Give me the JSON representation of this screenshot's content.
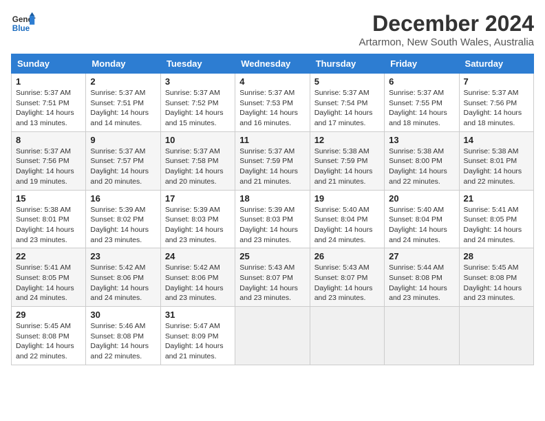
{
  "header": {
    "logo_line1": "General",
    "logo_line2": "Blue",
    "month": "December 2024",
    "location": "Artarmon, New South Wales, Australia"
  },
  "weekdays": [
    "Sunday",
    "Monday",
    "Tuesday",
    "Wednesday",
    "Thursday",
    "Friday",
    "Saturday"
  ],
  "weeks": [
    [
      {
        "day": "1",
        "sunrise": "Sunrise: 5:37 AM",
        "sunset": "Sunset: 7:51 PM",
        "daylight": "Daylight: 14 hours and 13 minutes."
      },
      {
        "day": "2",
        "sunrise": "Sunrise: 5:37 AM",
        "sunset": "Sunset: 7:51 PM",
        "daylight": "Daylight: 14 hours and 14 minutes."
      },
      {
        "day": "3",
        "sunrise": "Sunrise: 5:37 AM",
        "sunset": "Sunset: 7:52 PM",
        "daylight": "Daylight: 14 hours and 15 minutes."
      },
      {
        "day": "4",
        "sunrise": "Sunrise: 5:37 AM",
        "sunset": "Sunset: 7:53 PM",
        "daylight": "Daylight: 14 hours and 16 minutes."
      },
      {
        "day": "5",
        "sunrise": "Sunrise: 5:37 AM",
        "sunset": "Sunset: 7:54 PM",
        "daylight": "Daylight: 14 hours and 17 minutes."
      },
      {
        "day": "6",
        "sunrise": "Sunrise: 5:37 AM",
        "sunset": "Sunset: 7:55 PM",
        "daylight": "Daylight: 14 hours and 18 minutes."
      },
      {
        "day": "7",
        "sunrise": "Sunrise: 5:37 AM",
        "sunset": "Sunset: 7:56 PM",
        "daylight": "Daylight: 14 hours and 18 minutes."
      }
    ],
    [
      {
        "day": "8",
        "sunrise": "Sunrise: 5:37 AM",
        "sunset": "Sunset: 7:56 PM",
        "daylight": "Daylight: 14 hours and 19 minutes."
      },
      {
        "day": "9",
        "sunrise": "Sunrise: 5:37 AM",
        "sunset": "Sunset: 7:57 PM",
        "daylight": "Daylight: 14 hours and 20 minutes."
      },
      {
        "day": "10",
        "sunrise": "Sunrise: 5:37 AM",
        "sunset": "Sunset: 7:58 PM",
        "daylight": "Daylight: 14 hours and 20 minutes."
      },
      {
        "day": "11",
        "sunrise": "Sunrise: 5:37 AM",
        "sunset": "Sunset: 7:59 PM",
        "daylight": "Daylight: 14 hours and 21 minutes."
      },
      {
        "day": "12",
        "sunrise": "Sunrise: 5:38 AM",
        "sunset": "Sunset: 7:59 PM",
        "daylight": "Daylight: 14 hours and 21 minutes."
      },
      {
        "day": "13",
        "sunrise": "Sunrise: 5:38 AM",
        "sunset": "Sunset: 8:00 PM",
        "daylight": "Daylight: 14 hours and 22 minutes."
      },
      {
        "day": "14",
        "sunrise": "Sunrise: 5:38 AM",
        "sunset": "Sunset: 8:01 PM",
        "daylight": "Daylight: 14 hours and 22 minutes."
      }
    ],
    [
      {
        "day": "15",
        "sunrise": "Sunrise: 5:38 AM",
        "sunset": "Sunset: 8:01 PM",
        "daylight": "Daylight: 14 hours and 23 minutes."
      },
      {
        "day": "16",
        "sunrise": "Sunrise: 5:39 AM",
        "sunset": "Sunset: 8:02 PM",
        "daylight": "Daylight: 14 hours and 23 minutes."
      },
      {
        "day": "17",
        "sunrise": "Sunrise: 5:39 AM",
        "sunset": "Sunset: 8:03 PM",
        "daylight": "Daylight: 14 hours and 23 minutes."
      },
      {
        "day": "18",
        "sunrise": "Sunrise: 5:39 AM",
        "sunset": "Sunset: 8:03 PM",
        "daylight": "Daylight: 14 hours and 23 minutes."
      },
      {
        "day": "19",
        "sunrise": "Sunrise: 5:40 AM",
        "sunset": "Sunset: 8:04 PM",
        "daylight": "Daylight: 14 hours and 24 minutes."
      },
      {
        "day": "20",
        "sunrise": "Sunrise: 5:40 AM",
        "sunset": "Sunset: 8:04 PM",
        "daylight": "Daylight: 14 hours and 24 minutes."
      },
      {
        "day": "21",
        "sunrise": "Sunrise: 5:41 AM",
        "sunset": "Sunset: 8:05 PM",
        "daylight": "Daylight: 14 hours and 24 minutes."
      }
    ],
    [
      {
        "day": "22",
        "sunrise": "Sunrise: 5:41 AM",
        "sunset": "Sunset: 8:05 PM",
        "daylight": "Daylight: 14 hours and 24 minutes."
      },
      {
        "day": "23",
        "sunrise": "Sunrise: 5:42 AM",
        "sunset": "Sunset: 8:06 PM",
        "daylight": "Daylight: 14 hours and 24 minutes."
      },
      {
        "day": "24",
        "sunrise": "Sunrise: 5:42 AM",
        "sunset": "Sunset: 8:06 PM",
        "daylight": "Daylight: 14 hours and 23 minutes."
      },
      {
        "day": "25",
        "sunrise": "Sunrise: 5:43 AM",
        "sunset": "Sunset: 8:07 PM",
        "daylight": "Daylight: 14 hours and 23 minutes."
      },
      {
        "day": "26",
        "sunrise": "Sunrise: 5:43 AM",
        "sunset": "Sunset: 8:07 PM",
        "daylight": "Daylight: 14 hours and 23 minutes."
      },
      {
        "day": "27",
        "sunrise": "Sunrise: 5:44 AM",
        "sunset": "Sunset: 8:08 PM",
        "daylight": "Daylight: 14 hours and 23 minutes."
      },
      {
        "day": "28",
        "sunrise": "Sunrise: 5:45 AM",
        "sunset": "Sunset: 8:08 PM",
        "daylight": "Daylight: 14 hours and 23 minutes."
      }
    ],
    [
      {
        "day": "29",
        "sunrise": "Sunrise: 5:45 AM",
        "sunset": "Sunset: 8:08 PM",
        "daylight": "Daylight: 14 hours and 22 minutes."
      },
      {
        "day": "30",
        "sunrise": "Sunrise: 5:46 AM",
        "sunset": "Sunset: 8:08 PM",
        "daylight": "Daylight: 14 hours and 22 minutes."
      },
      {
        "day": "31",
        "sunrise": "Sunrise: 5:47 AM",
        "sunset": "Sunset: 8:09 PM",
        "daylight": "Daylight: 14 hours and 21 minutes."
      },
      null,
      null,
      null,
      null
    ]
  ]
}
